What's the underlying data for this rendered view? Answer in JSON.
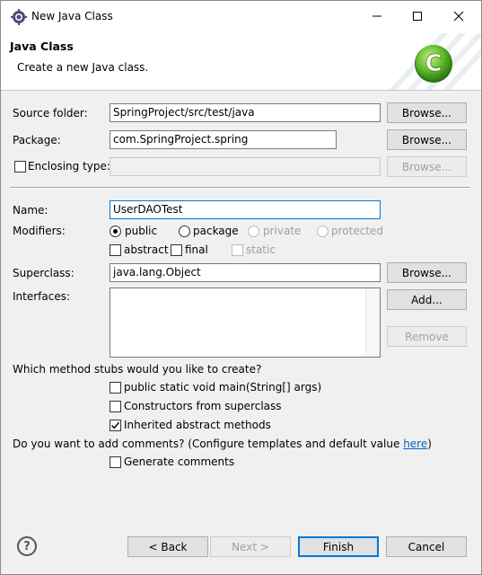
{
  "window": {
    "title": "New Java Class",
    "title_icon": "eclipse-gear-icon"
  },
  "banner": {
    "title": "Java Class",
    "message": "Create a new Java class.",
    "logo_icon": "java-class-c-logo-icon",
    "logo_letter": "C"
  },
  "source_folder": {
    "label": "Source folder:",
    "value": "SpringProject/src/test/java",
    "browse_label": "Browse..."
  },
  "package": {
    "label": "Package:",
    "value": "com.SpringProject.spring",
    "browse_label": "Browse..."
  },
  "enclosing_type": {
    "label": "Enclosing type:",
    "checked": false,
    "value": "",
    "browse_label": "Browse..."
  },
  "name": {
    "label": "Name:",
    "value": "UserDAOTest"
  },
  "modifiers": {
    "label": "Modifiers:",
    "access": [
      {
        "label": "public",
        "selected": true,
        "enabled": true
      },
      {
        "label": "package",
        "selected": false,
        "enabled": true
      },
      {
        "label": "private",
        "selected": false,
        "enabled": false
      },
      {
        "label": "protected",
        "selected": false,
        "enabled": false
      }
    ],
    "flags": [
      {
        "label": "abstract",
        "checked": false,
        "enabled": true
      },
      {
        "label": "final",
        "checked": false,
        "enabled": true
      },
      {
        "label": "static",
        "checked": false,
        "enabled": false
      }
    ]
  },
  "superclass": {
    "label": "Superclass:",
    "value": "java.lang.Object",
    "browse_label": "Browse..."
  },
  "interfaces": {
    "label": "Interfaces:",
    "add_label": "Add...",
    "remove_label": "Remove",
    "items": []
  },
  "stubs": {
    "question": "Which method stubs would you like to create?",
    "options": [
      {
        "label": "public static void main(String[] args)",
        "checked": false
      },
      {
        "label": "Constructors from superclass",
        "checked": false
      },
      {
        "label": "Inherited abstract methods",
        "checked": true
      }
    ]
  },
  "comments": {
    "question_prefix": "Do you want to add comments? (Configure templates and default value ",
    "link_text": "here",
    "question_suffix": ")",
    "option_label": "Generate comments",
    "checked": false
  },
  "footer": {
    "help_symbol": "?",
    "back_label": "< Back",
    "next_label": "Next >",
    "finish_label": "Finish",
    "cancel_label": "Cancel"
  }
}
